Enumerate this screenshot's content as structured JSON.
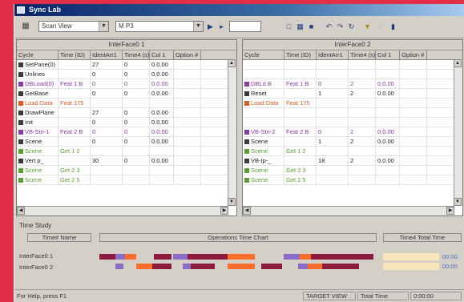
{
  "window": {
    "title": "Sync Lab"
  },
  "toolbar": {
    "combo1": "Scan View",
    "combo2": "M P3",
    "field": "",
    "icons": [
      "grid-icon",
      "play-icon",
      "step-icon",
      "stop-icon",
      "copy-icon",
      "paste-icon",
      "undo-icon",
      "redo-icon",
      "loop-icon",
      "filter-icon",
      "close-icon",
      "print-icon"
    ]
  },
  "left_pane": {
    "title": "InterFace0 1",
    "columns": [
      "Cycle",
      "Time (ID)",
      "IdentArr1",
      "Time4 (s)",
      "Col 1",
      "Option #"
    ],
    "rows": [
      {
        "kind": "normal",
        "cells": [
          "SetPane(0)",
          "",
          "27",
          "0",
          "0.0.00",
          ""
        ]
      },
      {
        "kind": "normal",
        "cells": [
          "Unlines",
          "",
          "0",
          "0",
          "0.0.00",
          ""
        ]
      },
      {
        "kind": "purple",
        "cells": [
          "DBLoad(0)",
          "Feat 1 B",
          "0",
          "0",
          "0.0.00",
          ""
        ]
      },
      {
        "kind": "normal",
        "cells": [
          "GetBase",
          "",
          "0",
          "0",
          "0.0.00",
          ""
        ]
      },
      {
        "kind": "orange",
        "cells": [
          "Load Data",
          "Feat 175",
          "",
          "",
          "",
          ""
        ]
      },
      {
        "kind": "normal",
        "cells": [
          "DrawPlane",
          "",
          "27",
          "0",
          "0.0.00",
          ""
        ]
      },
      {
        "kind": "normal",
        "cells": [
          "Init",
          "",
          "0",
          "0",
          "0.0.00",
          ""
        ]
      },
      {
        "kind": "purple",
        "cells": [
          "VB-Stn-1",
          "Feat 2 B",
          "0",
          "0",
          "0.0.00",
          ""
        ]
      },
      {
        "kind": "normal",
        "cells": [
          "Scene",
          "",
          "0",
          "0",
          "0.0.00",
          ""
        ]
      },
      {
        "kind": "green",
        "cells": [
          "Scene",
          "Get 1 2",
          "",
          "",
          "",
          ""
        ]
      },
      {
        "kind": "normal",
        "cells": [
          "Vert p_",
          "",
          "30",
          "0",
          "0.0.00",
          ""
        ]
      },
      {
        "kind": "green",
        "cells": [
          "Scene",
          "Get 2 3",
          "",
          "",
          "",
          ""
        ]
      },
      {
        "kind": "green",
        "cells": [
          "Scene",
          "Get 2 5",
          "",
          "",
          "",
          ""
        ]
      }
    ]
  },
  "right_pane": {
    "title": "InterFace0 2",
    "columns": [
      "Cycle",
      "Time (ID)",
      "IdentArr1",
      "Time4 (s)",
      "Col 1",
      "Option #"
    ],
    "rows": [
      {
        "kind": "empty",
        "cells": [
          "",
          "",
          "",
          "",
          "",
          ""
        ]
      },
      {
        "kind": "empty",
        "cells": [
          "",
          "",
          "",
          "",
          "",
          ""
        ]
      },
      {
        "kind": "purple",
        "cells": [
          "DBLd B",
          "Feat 1 B",
          "0",
          "2",
          "0.0.00",
          ""
        ]
      },
      {
        "kind": "normal",
        "cells": [
          "Reset",
          "",
          "1",
          "2",
          "0.0.00",
          ""
        ]
      },
      {
        "kind": "orange",
        "cells": [
          "Load Data",
          "Feat 175",
          "",
          "",
          "",
          ""
        ]
      },
      {
        "kind": "empty",
        "cells": [
          "",
          "",
          "",
          "",
          "",
          ""
        ]
      },
      {
        "kind": "empty",
        "cells": [
          "",
          "",
          "",
          "",
          "",
          ""
        ]
      },
      {
        "kind": "purple",
        "cells": [
          "VB-Stn-2",
          "Feat 2 B",
          "0",
          "2",
          "0.0.00",
          ""
        ]
      },
      {
        "kind": "normal",
        "cells": [
          "Scene",
          "",
          "1",
          "2",
          "0.0.00",
          ""
        ]
      },
      {
        "kind": "green",
        "cells": [
          "Scene",
          "Get 1 2",
          "",
          "",
          "",
          ""
        ]
      },
      {
        "kind": "normal",
        "cells": [
          "VB-Ip-_",
          "",
          "18",
          "2",
          "0.0.00",
          ""
        ]
      },
      {
        "kind": "green",
        "cells": [
          "Scene",
          "Get 2 3",
          "",
          "",
          "",
          ""
        ]
      },
      {
        "kind": "green",
        "cells": [
          "Scene",
          "Get 2 5",
          "",
          "",
          "",
          ""
        ]
      }
    ]
  },
  "timestudy": {
    "label": "Time Study",
    "headers": [
      "Time# Name",
      "Operations Time Chart",
      "Time4 Total Time"
    ],
    "names": [
      "InterFace0 1",
      "InterFace0 2"
    ],
    "totals": [
      "00:00",
      "00:00"
    ],
    "colors": {
      "maroon": "#8b1a3c",
      "purple": "#8b6cc4",
      "orange": "#ff6d2a",
      "tan": "#f6e6b8"
    }
  },
  "status": {
    "left": "For Help, press F1",
    "s1": "TARGET VIEW",
    "s2": "Total Time",
    "s3": "0:00:00"
  }
}
